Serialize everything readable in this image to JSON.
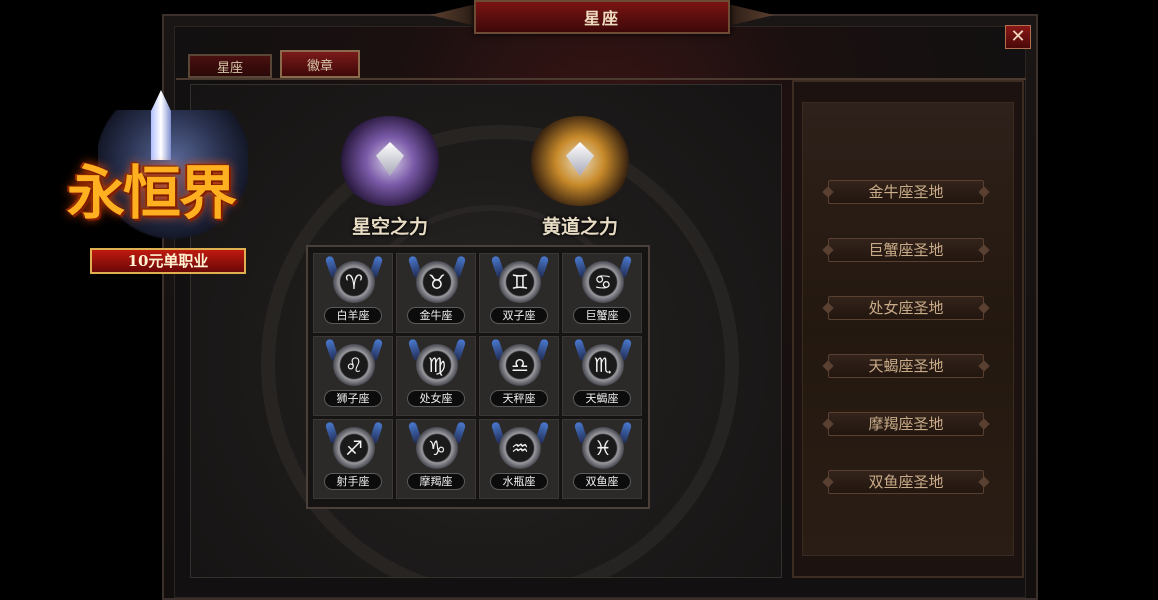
{
  "window": {
    "title": "星座",
    "close_symbol": "✕"
  },
  "tabs": [
    {
      "label": "星座"
    },
    {
      "label": "徽章"
    }
  ],
  "powers": [
    {
      "label": "星空之力",
      "color": "#8a6ac0"
    },
    {
      "label": "黄道之力",
      "color": "#d0902a"
    }
  ],
  "zodiac": [
    {
      "name": "白羊座",
      "glyph": "♈"
    },
    {
      "name": "金牛座",
      "glyph": "♉"
    },
    {
      "name": "双子座",
      "glyph": "♊"
    },
    {
      "name": "巨蟹座",
      "glyph": "♋"
    },
    {
      "name": "狮子座",
      "glyph": "♌"
    },
    {
      "name": "处女座",
      "glyph": "♍"
    },
    {
      "name": "天秤座",
      "glyph": "♎"
    },
    {
      "name": "天蝎座",
      "glyph": "♏"
    },
    {
      "name": "射手座",
      "glyph": "♐"
    },
    {
      "name": "摩羯座",
      "glyph": "♑"
    },
    {
      "name": "水瓶座",
      "glyph": "♒"
    },
    {
      "name": "双鱼座",
      "glyph": "♓"
    }
  ],
  "sanctuaries": [
    {
      "label": "金牛座圣地"
    },
    {
      "label": "巨蟹座圣地"
    },
    {
      "label": "处女座圣地"
    },
    {
      "label": "天蝎座圣地"
    },
    {
      "label": "摩羯座圣地"
    },
    {
      "label": "双鱼座圣地"
    }
  ],
  "logo": {
    "title": "永恒界",
    "ribbon": "10元单职业"
  }
}
